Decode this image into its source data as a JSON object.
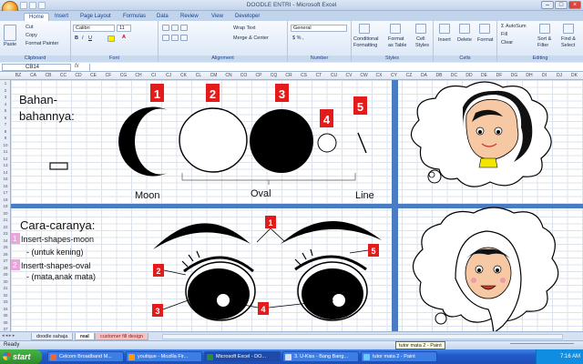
{
  "window": {
    "title": "DOODLE ENTRI - Microsoft Excel"
  },
  "tabs": [
    "Home",
    "Insert",
    "Page Layout",
    "Formulas",
    "Data",
    "Review",
    "View",
    "Developer"
  ],
  "ribbon": {
    "clipboard": {
      "label": "Clipboard",
      "paste": "Paste",
      "cut": "Cut",
      "copy": "Copy",
      "painter": "Format Painter"
    },
    "font": {
      "label": "Font",
      "name": "Calibri",
      "size": "11"
    },
    "alignment": {
      "label": "Alignment",
      "wrap": "Wrap Text",
      "merge": "Merge & Center"
    },
    "number": {
      "label": "Number",
      "format": "General",
      "pct": "$ % ,"
    },
    "styles": {
      "label": "Styles",
      "cond": "Conditional",
      "cond2": "Formatting",
      "table": "Format",
      "table2": "as Table",
      "cell": "Cell",
      "cell2": "Styles"
    },
    "cells": {
      "label": "Cells",
      "insert": "Insert",
      "delete": "Delete",
      "format": "Format"
    },
    "editing": {
      "label": "Editing",
      "autosum": "AutoSum",
      "fill": "Fill",
      "clear": "Clear",
      "sort": "Sort &",
      "sort2": "Filter",
      "find": "Find &",
      "find2": "Select"
    }
  },
  "formula_bar": {
    "name_box": "CB14",
    "fx": "fx"
  },
  "columns": [
    "BZ",
    "CA",
    "CB",
    "CC",
    "CD",
    "CE",
    "CF",
    "CG",
    "CH",
    "CI",
    "CJ",
    "CK",
    "CL",
    "CM",
    "CN",
    "CO",
    "CP",
    "CQ",
    "CR",
    "CS",
    "CT",
    "CU",
    "CV",
    "CW",
    "CX",
    "CY",
    "CZ",
    "DA",
    "DB",
    "DC",
    "DD",
    "DE",
    "DF",
    "DG",
    "DH",
    "DI",
    "DJ",
    "DK"
  ],
  "rows": [
    "1",
    "2",
    "3",
    "4",
    "5",
    "6",
    "7",
    "8",
    "9",
    "10",
    "11",
    "12",
    "13",
    "14",
    "15",
    "16",
    "17",
    "18",
    "19",
    "20",
    "21",
    "22",
    "23",
    "24",
    "25",
    "26",
    "27",
    "28",
    "29",
    "30",
    "31",
    "32",
    "33",
    "34",
    "35",
    "36",
    "37"
  ],
  "content": {
    "bahan1": "Bahan-",
    "bahan2": "bahannya:",
    "n1": "1",
    "n2": "2",
    "n3": "3",
    "n4": "4",
    "n5": "5",
    "moon": "Moon",
    "oval": "Oval",
    "line": "Line",
    "cara": "Cara-caranya:",
    "s1n": "1",
    "s1": "Insert-shapes-moon",
    "s1b": "- (untuk kening)",
    "s2n": "2",
    "s2": "Insertt-shapes-oval",
    "s2b": "- (mata,anak mata)",
    "e1": "1",
    "e2": "2",
    "e3": "3",
    "e4": "4",
    "e5": "5"
  },
  "sheets": [
    "doodle sahaja",
    "real",
    "customer fill design"
  ],
  "status": {
    "ready": "Ready",
    "tooltip": "tutor mata 2 - Paint"
  },
  "taskbar": {
    "start": "start",
    "items": [
      "Celcom Broadband M...",
      "youtique - Mozilla Fir...",
      "Microsoft Excel - DO...",
      "3. U-Kiss - Bang Bang...",
      "tutor mata 2 - Paint"
    ],
    "clock": "7:16 AM"
  }
}
